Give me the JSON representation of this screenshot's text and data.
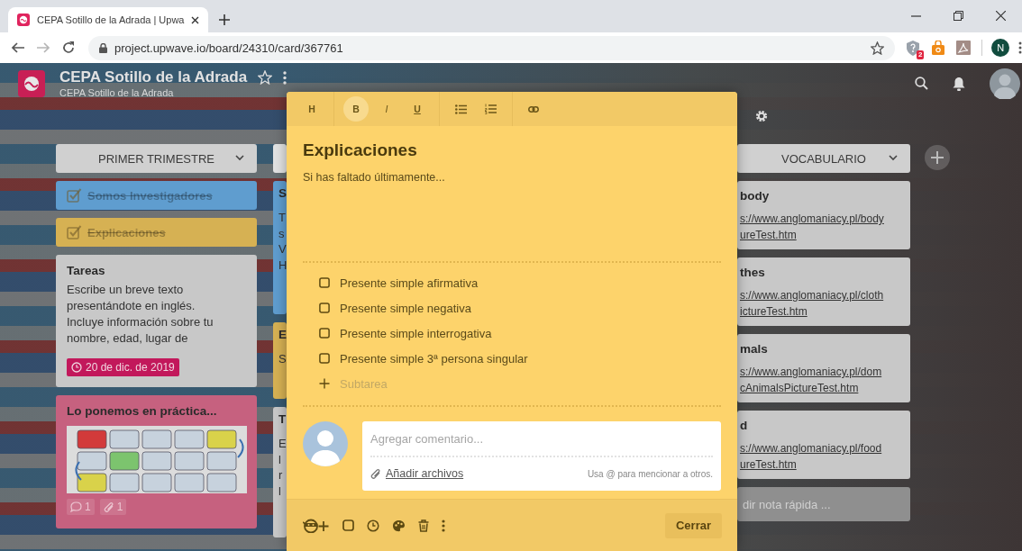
{
  "browser": {
    "tab": {
      "title": "CEPA Sotillo de la Adrada | Upwa"
    },
    "nav": [
      {
        "kind": "back",
        "disabled": false
      },
      {
        "kind": "forward",
        "disabled": true
      },
      {
        "kind": "reload",
        "disabled": false
      }
    ],
    "url": "project.upwave.io/board/24310/card/367761",
    "extensions": [
      {
        "kind": "shield",
        "badge": "2"
      },
      {
        "kind": "bag"
      },
      {
        "kind": "pdf"
      }
    ],
    "profile_initial": "N"
  },
  "board": {
    "title": "CEPA Sotillo de la Adrada",
    "subtitle": "CEPA Sotillo de la Adrada"
  },
  "lists": [
    {
      "title": "PRIMER TRIMESTRE",
      "cards": [
        {
          "kind": "compact",
          "title": "Somos Investigadores",
          "done": true,
          "color": "#5f9dcf"
        },
        {
          "kind": "compact",
          "title": "Explicaciones",
          "done": true,
          "color": "#d6b153"
        },
        {
          "kind": "text",
          "title": "Tareas",
          "body": "Escribe un breve texto\npresentándote en inglés.\nIncluye información sobre tu\nnombre, edad, lugar de",
          "due": "20 de dic. de 2019",
          "color": "#c8c8c8"
        },
        {
          "kind": "image",
          "title": "Lo ponemos en práctica...",
          "comments": "1",
          "attachments": "1",
          "color": "#c6617f"
        }
      ]
    },
    {
      "cards": [
        {
          "kind": "text",
          "title": "S",
          "body": "T\ns\nV\nH",
          "color": "#5f9dcf"
        },
        {
          "kind": "text",
          "title": "E",
          "body": "S",
          "color": "#d6b153"
        },
        {
          "kind": "text",
          "title": "T",
          "body": "E\nl\nr\nl",
          "color": "#c8c8c8"
        }
      ]
    },
    {
      "title": "VOCABULARIO",
      "cards": [
        {
          "kind": "link",
          "title": "body",
          "link": "s://www.anglomaniacy.pl/body\nureTest.htm",
          "color": "#c8c8c8"
        },
        {
          "kind": "link",
          "title": "thes",
          "link": "s://www.anglomaniacy.pl/cloth\nictureTest.htm",
          "color": "#c8c8c8"
        },
        {
          "kind": "link",
          "title": "mals",
          "link": "s://www.anglomaniacy.pl/dom\ncAnimalsPictureTest.htm",
          "color": "#c8c8c8"
        },
        {
          "kind": "link",
          "title": "d",
          "link": "s://www.anglomaniacy.pl/food\nureTest.htm",
          "color": "#c8c8c8"
        }
      ],
      "quick_note": {
        "placeholder": "dir nota rápida ..."
      }
    }
  ],
  "modal": {
    "toolbar": [
      [
        {
          "kind": "heading",
          "label": "H",
          "selected": false
        }
      ],
      [
        {
          "kind": "bold",
          "label": "B",
          "selected": true
        },
        {
          "kind": "italic",
          "label": "I",
          "selected": false
        },
        {
          "kind": "underline",
          "label": "U",
          "selected": false
        }
      ],
      [
        {
          "kind": "bullets"
        },
        {
          "kind": "numbers"
        }
      ],
      [
        {
          "kind": "link"
        }
      ]
    ],
    "title": "Explicaciones",
    "description": "Si has faltado últimamente...",
    "subtasks": [
      {
        "label": "Presente simple afirmativa",
        "checked": false
      },
      {
        "label": "Presente simple negativa",
        "checked": false
      },
      {
        "label": "Presente simple interrogativa",
        "checked": false
      },
      {
        "label": "Presente simple 3ª persona singular",
        "checked": false
      }
    ],
    "new_subtask": {
      "placeholder": "Subtarea"
    },
    "comment": {
      "placeholder": "Agregar comentario...",
      "attach": "Añadir archivos",
      "hint": "Usa @ para mencionar a otros."
    },
    "close": "Cerrar"
  }
}
